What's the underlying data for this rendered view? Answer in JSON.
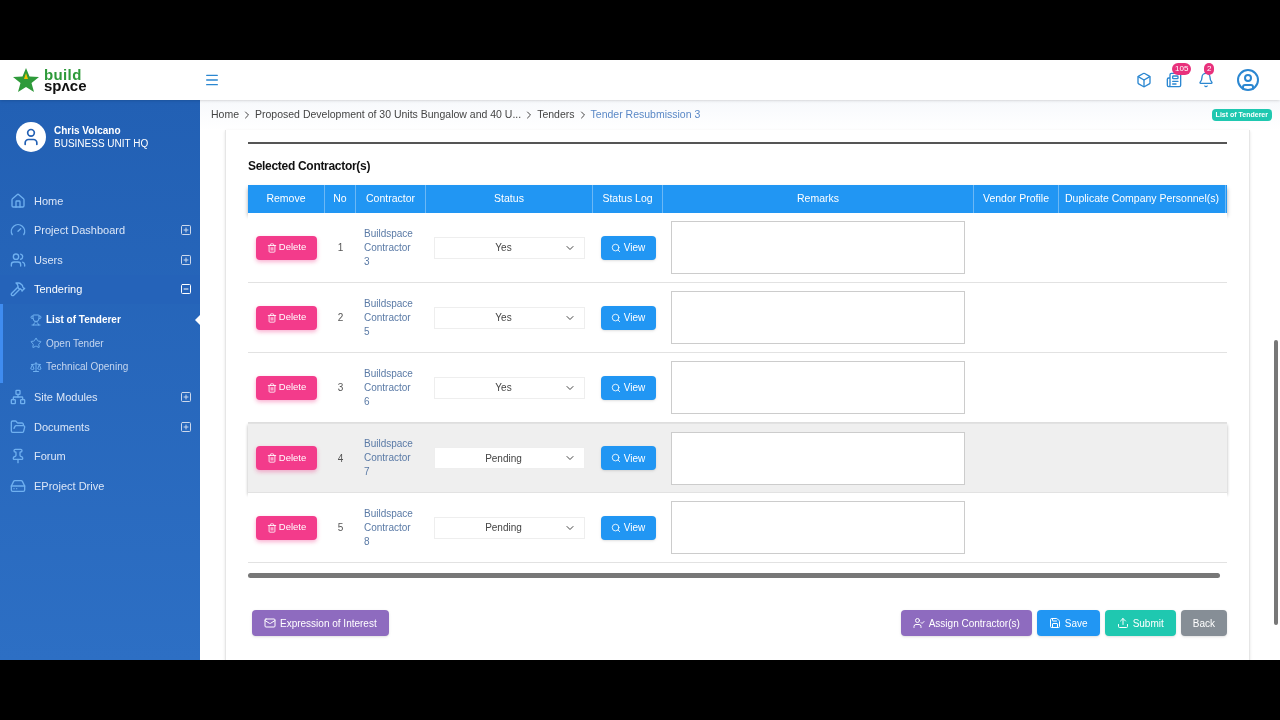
{
  "logo": {
    "top": "build",
    "bottom": "spʌce"
  },
  "header": {
    "badges": [
      {
        "count": "105"
      },
      {
        "count": "2"
      }
    ]
  },
  "user": {
    "name": "Chris Volcano",
    "unit": "BUSINESS UNIT HQ"
  },
  "sidebar": {
    "items": [
      {
        "label": "Home",
        "kind": "link"
      },
      {
        "label": "Project Dashboard",
        "kind": "expandable",
        "expanded": false
      },
      {
        "label": "Users",
        "kind": "expandable",
        "expanded": false
      },
      {
        "label": "Tendering",
        "kind": "expandable",
        "expanded": true,
        "children": [
          {
            "label": "List of Tenderer",
            "selected": true
          },
          {
            "label": "Open Tender",
            "selected": false
          },
          {
            "label": "Technical Opening",
            "selected": false
          }
        ]
      },
      {
        "label": "Site Modules",
        "kind": "expandable",
        "expanded": false
      },
      {
        "label": "Documents",
        "kind": "expandable",
        "expanded": false
      },
      {
        "label": "Forum",
        "kind": "link"
      },
      {
        "label": "EProject Drive",
        "kind": "link"
      }
    ]
  },
  "breadcrumb": [
    "Home",
    "Proposed Development of 30 Units Bungalow and 40 U...",
    "Tenders",
    "Tender Resubmission 3"
  ],
  "page_tag": "List of Tenderer",
  "section_title": "Selected Contractor(s)",
  "table": {
    "columns": [
      "Remove",
      "No",
      "Contractor",
      "Status",
      "Status Log",
      "Remarks",
      "Vendor Profile",
      "Duplicate Company Personnel(s)"
    ],
    "rows": [
      {
        "action": "Delete",
        "no": "1",
        "contractor": "Buildspace Contractor 3",
        "status": "Yes",
        "log": "View",
        "highlighted": false
      },
      {
        "action": "Delete",
        "no": "2",
        "contractor": "Buildspace Contractor 5",
        "status": "Yes",
        "log": "View",
        "highlighted": false
      },
      {
        "action": "Delete",
        "no": "3",
        "contractor": "Buildspace Contractor 6",
        "status": "Yes",
        "log": "View",
        "highlighted": false
      },
      {
        "action": "Delete",
        "no": "4",
        "contractor": "Buildspace Contractor 7",
        "status": "Pending",
        "log": "View",
        "highlighted": true
      },
      {
        "action": "Delete",
        "no": "5",
        "contractor": "Buildspace Contractor 8",
        "status": "Pending",
        "log": "View",
        "highlighted": false
      }
    ]
  },
  "buttons": [
    {
      "label": "Expression of Interest",
      "kind": "eoi"
    },
    {
      "label": "Assign Contractor(s)",
      "kind": "assign"
    },
    {
      "label": "Save",
      "kind": "save"
    },
    {
      "label": "Submit",
      "kind": "submit"
    },
    {
      "label": "Back",
      "kind": "back"
    }
  ]
}
